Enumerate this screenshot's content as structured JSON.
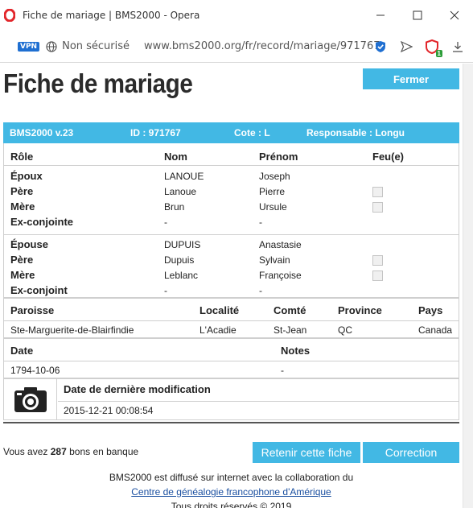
{
  "window": {
    "title": "Fiche de mariage | BMS2000 - Opera"
  },
  "address_bar": {
    "vpn": "VPN",
    "security": "Non sécurisé",
    "url": "www.bms2000.org/fr/record/mariage/971767",
    "badge_count": "1"
  },
  "page": {
    "title": "Fiche de mariage",
    "close_label": "Fermer"
  },
  "info": {
    "version": "BMS2000 v.23",
    "id": "ID : 971767",
    "cote": "Cote : L",
    "responsable": "Responsable : Longu"
  },
  "persons_table": {
    "headers": [
      "Rôle",
      "Nom",
      "Prénom",
      "Feu(e)"
    ],
    "groom_group": [
      {
        "role": "Époux",
        "nom": "LANOUE",
        "prenom": "Joseph",
        "feu": null
      },
      {
        "role": "Père",
        "nom": "Lanoue",
        "prenom": "Pierre",
        "feu": false
      },
      {
        "role": "Mère",
        "nom": "Brun",
        "prenom": "Ursule",
        "feu": false
      },
      {
        "role": "Ex-conjointe",
        "nom": "-",
        "prenom": "-",
        "feu": null
      }
    ],
    "bride_group": [
      {
        "role": "Épouse",
        "nom": "DUPUIS",
        "prenom": "Anastasie",
        "feu": null
      },
      {
        "role": "Père",
        "nom": "Dupuis",
        "prenom": "Sylvain",
        "feu": false
      },
      {
        "role": "Mère",
        "nom": "Leblanc",
        "prenom": "Françoise",
        "feu": false
      },
      {
        "role": "Ex-conjoint",
        "nom": "-",
        "prenom": "-",
        "feu": null
      }
    ]
  },
  "place_table": {
    "headers": [
      "Paroisse",
      "Localité",
      "Comté",
      "Province",
      "Pays"
    ],
    "row": [
      "Ste-Marguerite-de-Blairfindie",
      "L'Acadie",
      "St-Jean",
      "QC",
      "Canada"
    ]
  },
  "date_table": {
    "headers": [
      "Date",
      "Notes"
    ],
    "row": [
      "1794-10-06",
      "-"
    ]
  },
  "modification": {
    "label": "Date de dernière modification",
    "value": "2015-12-21 00:08:54"
  },
  "bank": {
    "prefix": "Vous avez",
    "count": "287",
    "suffix": "bons en banque"
  },
  "actions": {
    "keep_label": "Retenir cette fiche",
    "correct_label": "Correction"
  },
  "footer": {
    "line1": "BMS2000 est diffusé sur internet avec la collaboration du",
    "link": "Centre de généalogie francophone d'Amérique",
    "line3": "Tous droits réservés © 2019"
  },
  "colors": {
    "accent": "#42b8e4",
    "opera_red": "#e2262b",
    "vpn_blue": "#1f6fd1"
  }
}
